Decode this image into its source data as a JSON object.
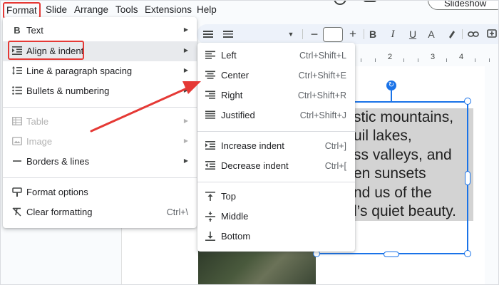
{
  "menubar": {
    "items": [
      "Format",
      "Slide",
      "Arrange",
      "Tools",
      "Extensions",
      "Help"
    ],
    "slideshow_label": "Slideshow"
  },
  "toolbar": {
    "font_size_value": "",
    "icons": [
      "align-icon",
      "line-spacing-icon",
      "dropdown-icon",
      "decrease-font-icon",
      "increase-font-icon",
      "bold-icon",
      "italic-icon",
      "underline-icon",
      "text-color-icon",
      "highlight-icon",
      "link-icon",
      "comment-icon"
    ]
  },
  "ruler": {
    "marks": [
      "2",
      "3",
      "4"
    ]
  },
  "format_menu": {
    "items": [
      {
        "label": "Text",
        "icon": "bold-icon",
        "has_submenu": true
      },
      {
        "label": "Align & indent",
        "icon": "align-indent-icon",
        "has_submenu": true
      },
      {
        "label": "Line & paragraph spacing",
        "icon": "line-spacing-icon",
        "has_submenu": true
      },
      {
        "label": "Bullets & numbering",
        "icon": "bullets-icon",
        "has_submenu": true
      },
      {
        "label": "Table",
        "icon": "table-icon",
        "has_submenu": true,
        "disabled": true
      },
      {
        "label": "Image",
        "icon": "image-icon",
        "has_submenu": true,
        "disabled": true
      },
      {
        "label": "Borders & lines",
        "icon": "borders-icon",
        "has_submenu": true
      },
      {
        "label": "Format options",
        "icon": "format-options-icon"
      },
      {
        "label": "Clear formatting",
        "icon": "clear-formatting-icon",
        "shortcut": "Ctrl+\\"
      }
    ]
  },
  "align_submenu": {
    "items": [
      {
        "label": "Left",
        "shortcut": "Ctrl+Shift+L",
        "icon": "align-left-icon"
      },
      {
        "label": "Center",
        "shortcut": "Ctrl+Shift+E",
        "icon": "align-center-icon"
      },
      {
        "label": "Right",
        "shortcut": "Ctrl+Shift+R",
        "icon": "align-right-icon"
      },
      {
        "label": "Justified",
        "shortcut": "Ctrl+Shift+J",
        "icon": "align-justify-icon"
      },
      {
        "label": "Increase indent",
        "shortcut": "Ctrl+]",
        "icon": "increase-indent-icon"
      },
      {
        "label": "Decrease indent",
        "shortcut": "Ctrl+[",
        "icon": "decrease-indent-icon"
      },
      {
        "label": "Top",
        "icon": "valign-top-icon"
      },
      {
        "label": "Middle",
        "icon": "valign-middle-icon"
      },
      {
        "label": "Bottom",
        "icon": "valign-bottom-icon"
      }
    ]
  },
  "slide_text": {
    "lines": [
      "stic mountains,",
      "uil lakes,",
      "ss valleys, and",
      "en sunsets",
      "nd us of the",
      "l’s quiet beauty."
    ]
  },
  "colors": {
    "annotation": "#e53935",
    "selection": "#1a73e8"
  }
}
